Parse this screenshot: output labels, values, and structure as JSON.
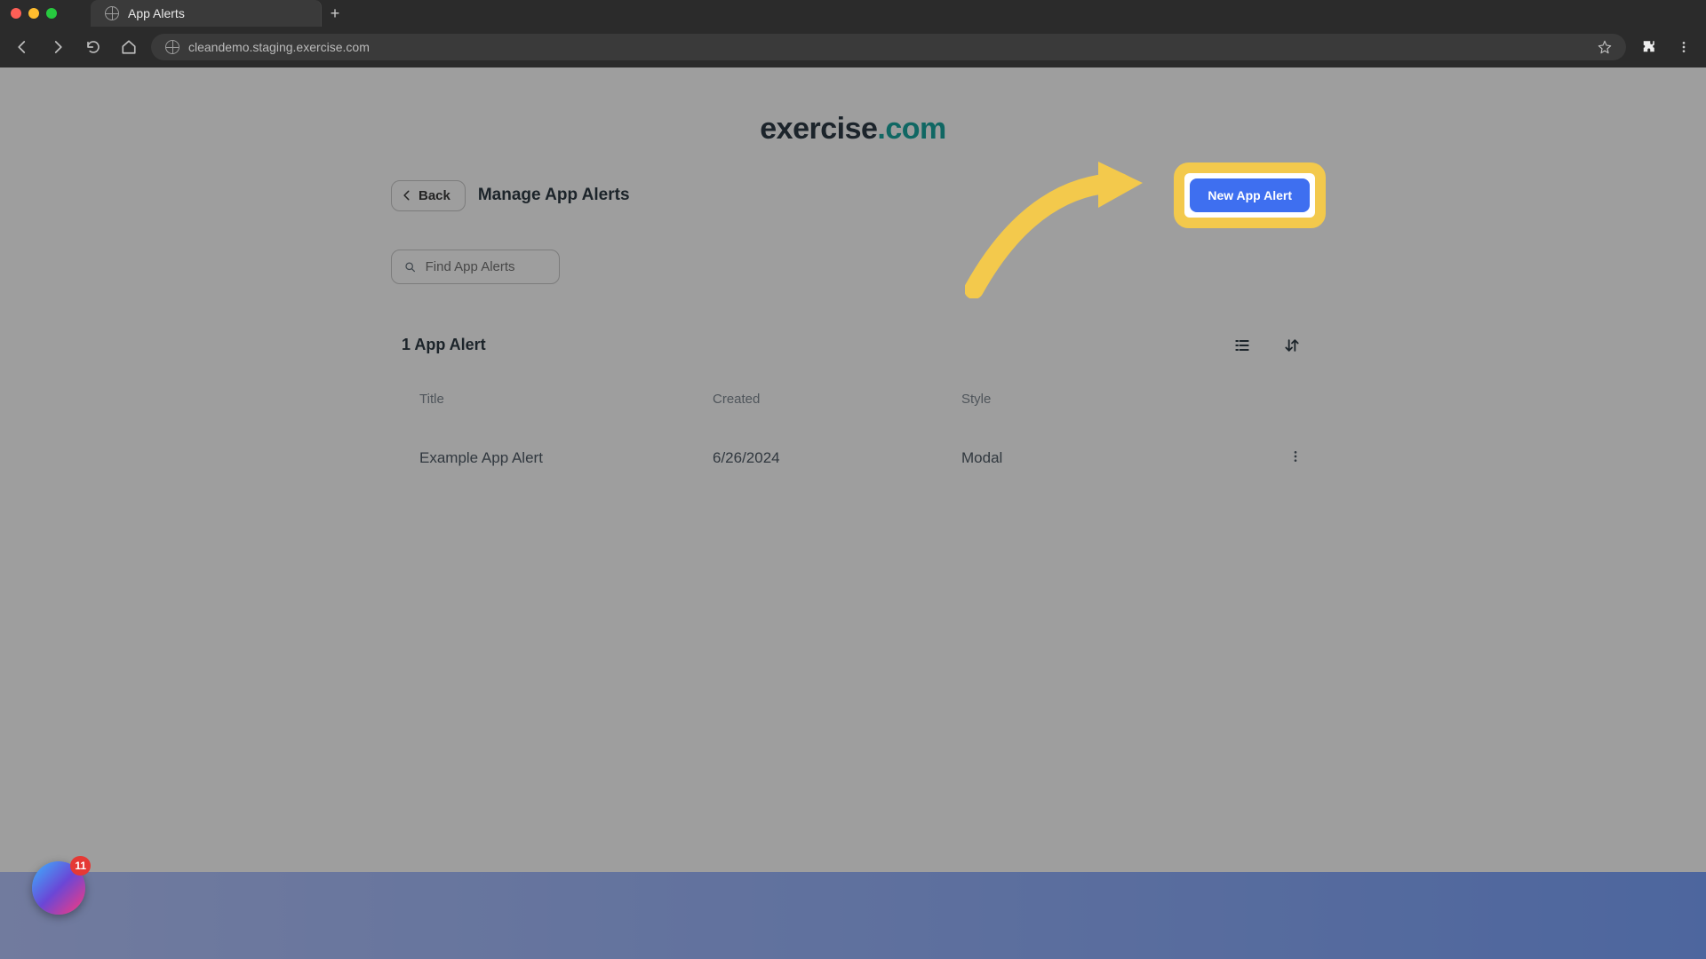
{
  "browser": {
    "tab_title": "App Alerts",
    "url": "cleandemo.staging.exercise.com",
    "traffic": {
      "close": "#ff5f56",
      "min": "#ffbd2e",
      "max": "#27c93f"
    }
  },
  "logo": {
    "part1": "exercise",
    "part2": ".com"
  },
  "header": {
    "back_label": "Back",
    "page_title": "Manage App Alerts",
    "new_button": "New App Alert"
  },
  "search": {
    "placeholder": "Find App Alerts"
  },
  "list": {
    "count_label": "1 App Alert",
    "columns": {
      "title": "Title",
      "created": "Created",
      "style": "Style"
    },
    "rows": [
      {
        "title": "Example App Alert",
        "created": "6/26/2024",
        "style": "Modal"
      }
    ]
  },
  "widget": {
    "badge": "11"
  }
}
